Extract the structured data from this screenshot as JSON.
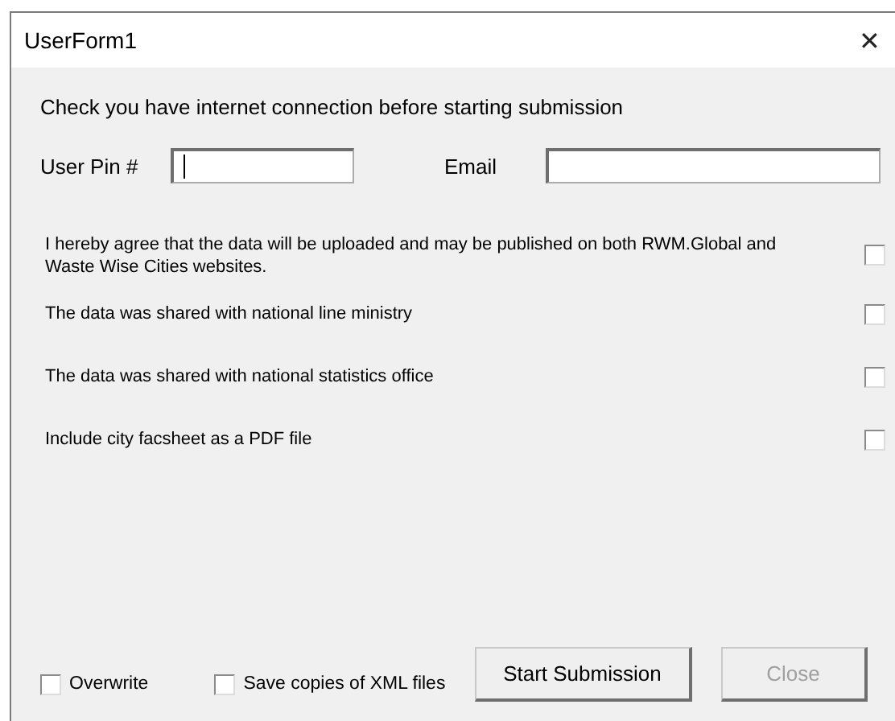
{
  "window": {
    "title": "UserForm1",
    "close": "✕"
  },
  "notice": "Check you have internet connection before starting submission",
  "fields": [
    {
      "label": "User Pin #",
      "focused": true
    },
    {
      "label": "Email",
      "focused": false
    }
  ],
  "agreements": [
    {
      "label": "I hereby agree that the data will be uploaded and may be published on both RWM.Global and Waste Wise Cities websites.",
      "checked": false
    },
    {
      "label": "The data was shared with national line ministry",
      "checked": false
    },
    {
      "label": "The data was shared with national statistics office",
      "checked": false
    },
    {
      "label": "Include city facsheet as a PDF file",
      "checked": false
    }
  ],
  "options": [
    {
      "label": "Overwrite",
      "checked": false
    },
    {
      "label": "Save copies of XML files",
      "checked": false
    }
  ],
  "buttons": [
    {
      "label": "Start Submission",
      "disabled": false
    },
    {
      "label": "Close",
      "disabled": true
    }
  ]
}
